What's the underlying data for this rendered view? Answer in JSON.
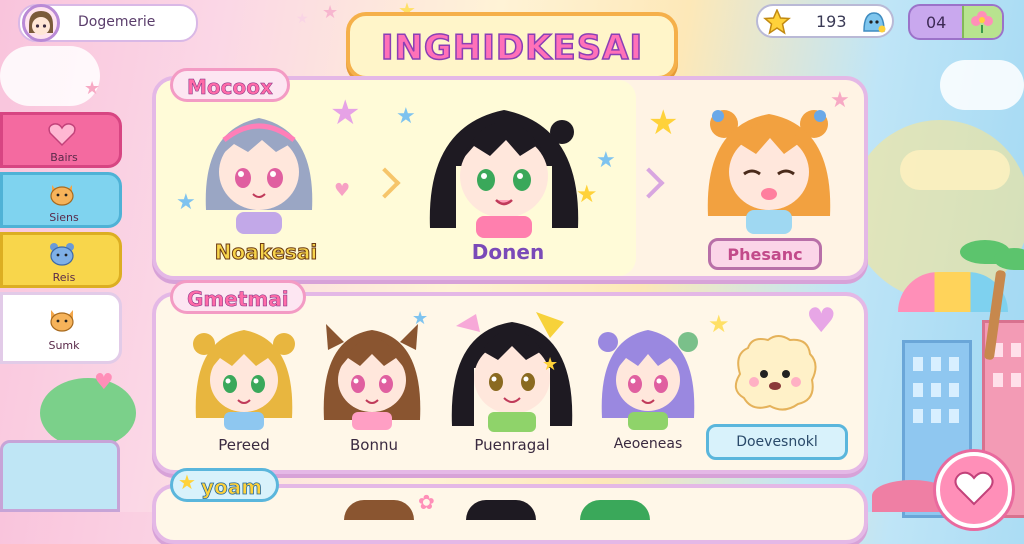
{
  "header": {
    "profile_name": "Dogemerie",
    "game_title": "INGHIDKESAI",
    "coins": "193",
    "energy": "04"
  },
  "sidebar": {
    "items": [
      {
        "label": "Bairs",
        "color": "#f46aa0",
        "icon": "heart-icon"
      },
      {
        "label": "Siens",
        "color": "#7fd3ef",
        "icon": "cat-icon"
      },
      {
        "label": "Reis",
        "color": "#f8d64b",
        "icon": "bear-icon"
      },
      {
        "label": "Sumk",
        "color": "#ffffff",
        "icon": "fox-icon"
      }
    ]
  },
  "featured": {
    "section_label": "Mocoox",
    "characters": [
      {
        "name": "Noakesai",
        "hair": "#9aa6c4",
        "eye": "#e05fa0"
      },
      {
        "name": "Donen",
        "hair": "#1e1a22",
        "eye": "#3aa85a"
      },
      {
        "name": "Phesanc",
        "hair": "#f2a140",
        "eye": "#4a2a1a"
      }
    ]
  },
  "roster": {
    "section_label": "Gmetmai",
    "characters": [
      {
        "name": "Pereed",
        "hair": "#e8b63f",
        "eye": "#3aa85a"
      },
      {
        "name": "Bonnu",
        "hair": "#8a5530",
        "eye": "#e05fa0"
      },
      {
        "name": "Puenragal",
        "hair": "#1e1a22",
        "eye": "#8a6a20"
      },
      {
        "name": "Aeoeneas",
        "hair": "#9a88e0",
        "eye": "#e05fa0"
      }
    ],
    "action_button": "Doevesnokl"
  },
  "third": {
    "section_label": "yoam"
  },
  "colors": {
    "accent": "#ff71b8",
    "panel_border": "#e4b8e6"
  }
}
